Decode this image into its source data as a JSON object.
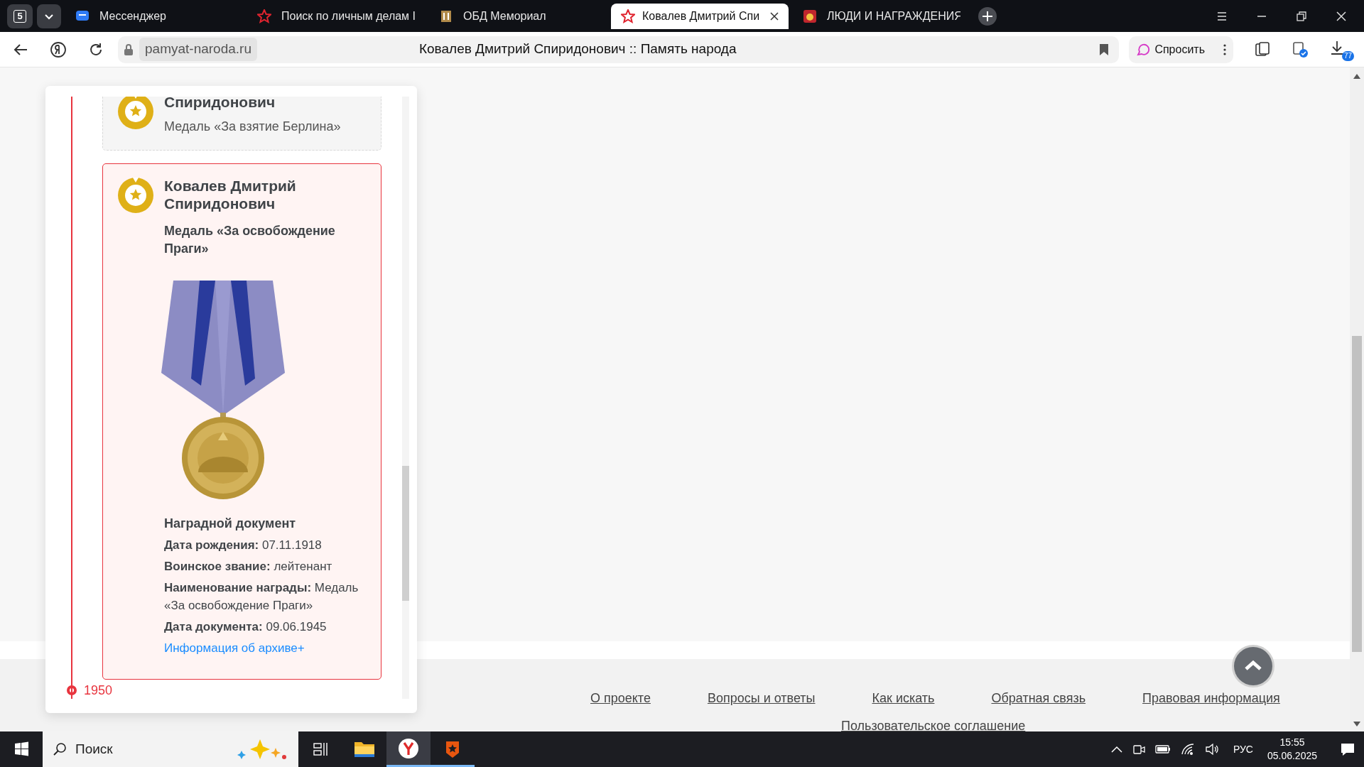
{
  "browser": {
    "tab_count": "5",
    "tabs": [
      {
        "title": "Мессенджер",
        "kind": "chat",
        "selected": false
      },
      {
        "title": "Поиск по личным делам I",
        "kind": "star",
        "selected": false
      },
      {
        "title": "ОБД Мемориал",
        "kind": "memorial",
        "selected": false
      },
      {
        "title": "Ковалев Дмитрий Спи",
        "kind": "star",
        "selected": true
      },
      {
        "title": "ЛЮДИ И НАГРАЖДЕНИЯ",
        "kind": "medal",
        "selected": false
      }
    ],
    "address": "pamyat-naroda.ru",
    "page_title": "Ковалев Дмитрий Спиридонович :: Память народа",
    "ask_button": "Спросить",
    "downloads_badge": "77"
  },
  "timeline": {
    "cards": [
      {
        "name": "Спиридонович",
        "award": "Медаль «За взятие Берлина»",
        "selected": false
      },
      {
        "name": "Ковалев Дмитрий Спиридонович",
        "award": "Медаль «За освобождение Праги»",
        "selected": true,
        "image": {
          "kind": "picture"
        },
        "document_title": "Наградной документ",
        "fields": [
          {
            "label": "Дата рождения:",
            "value": "07.11.1918"
          },
          {
            "label": "Воинское звание:",
            "value": "лейтенант"
          },
          {
            "label": "Наименование награды:",
            "value": "Медаль «За освобождение Праги»"
          },
          {
            "label": "Дата документа:",
            "value": "09.06.1945"
          }
        ],
        "archive_link": "Информация об архиве+"
      }
    ],
    "year": "1950"
  },
  "footer": {
    "links": [
      "О проекте",
      "Вопросы и ответы",
      "Как искать",
      "Обратная связь",
      "Правовая информация"
    ],
    "second_row": [
      "Пользовательское соглашение"
    ]
  },
  "taskbar": {
    "search": "Поиск",
    "language": "РУС",
    "time": "15:55",
    "date": "05.06.2025"
  }
}
